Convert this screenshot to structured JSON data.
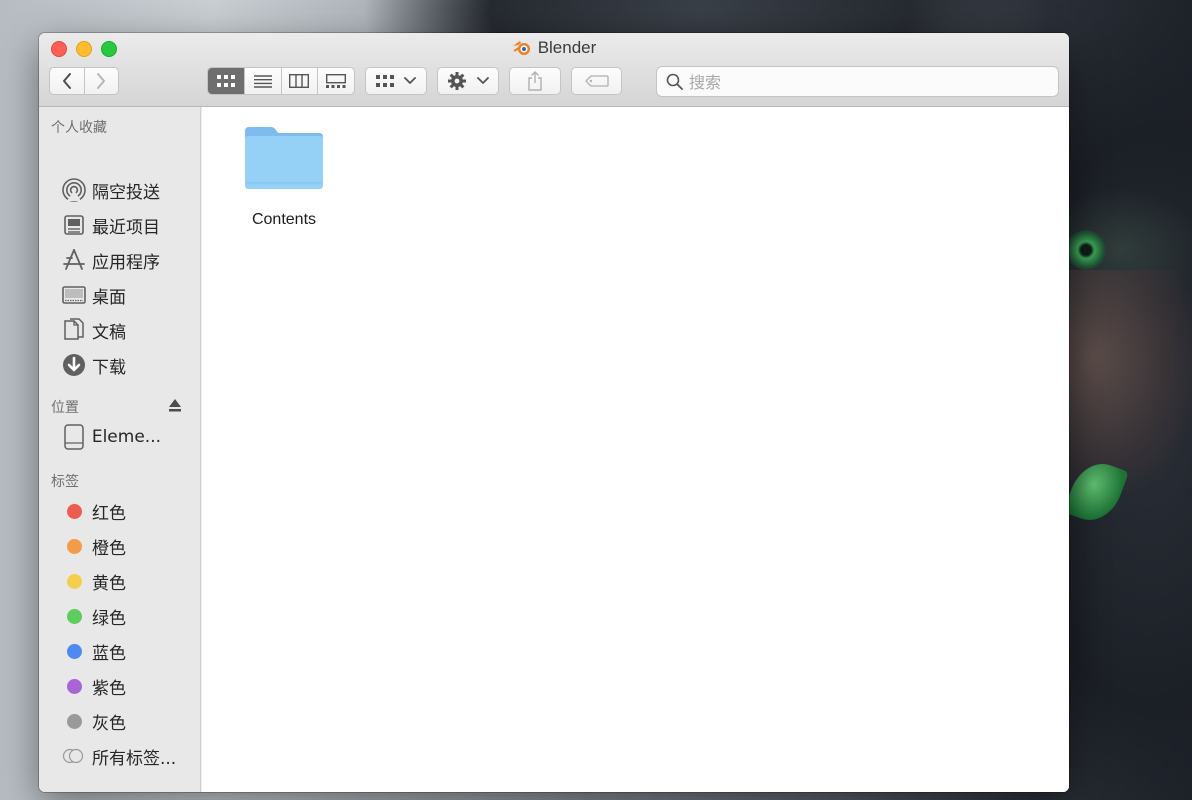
{
  "window": {
    "title": "Blender"
  },
  "toolbar": {
    "nav": {
      "back_icon": "chevron-left-icon",
      "forward_icon": "chevron-right-icon"
    },
    "view_modes": [
      {
        "name": "icon-view",
        "active": true
      },
      {
        "name": "list-view",
        "active": false
      },
      {
        "name": "column-view",
        "active": false
      },
      {
        "name": "gallery-view",
        "active": false
      }
    ],
    "search": {
      "placeholder": "搜索",
      "value": ""
    }
  },
  "sidebar": {
    "favorites_header": "个人收藏",
    "favorites": [
      {
        "label": "隔空投送",
        "icon": "airdrop-icon"
      },
      {
        "label": "最近项目",
        "icon": "recents-icon"
      },
      {
        "label": "应用程序",
        "icon": "applications-icon"
      },
      {
        "label": "桌面",
        "icon": "desktop-icon"
      },
      {
        "label": "文稿",
        "icon": "documents-icon"
      },
      {
        "label": "下载",
        "icon": "downloads-icon"
      }
    ],
    "locations_header": "位置",
    "locations": [
      {
        "label": "Eleme...",
        "icon": "disk-icon"
      }
    ],
    "tags_header": "标签",
    "tags": [
      {
        "label": "红色",
        "color": "#ee5c4f"
      },
      {
        "label": "橙色",
        "color": "#f39c48"
      },
      {
        "label": "黄色",
        "color": "#f6ce4d"
      },
      {
        "label": "绿色",
        "color": "#5fcc5f"
      },
      {
        "label": "蓝色",
        "color": "#4f8af0"
      },
      {
        "label": "紫色",
        "color": "#a965d6"
      },
      {
        "label": "灰色",
        "color": "#9a9a9a"
      }
    ],
    "all_tags": {
      "label": "所有标签...",
      "icon": "all-tags-icon"
    }
  },
  "content": {
    "items": [
      {
        "name": "Contents",
        "icon": "folder-icon"
      }
    ]
  },
  "colors": {
    "accent_blender": "#f07c1a",
    "folder_blue": "#8ac8f4"
  }
}
